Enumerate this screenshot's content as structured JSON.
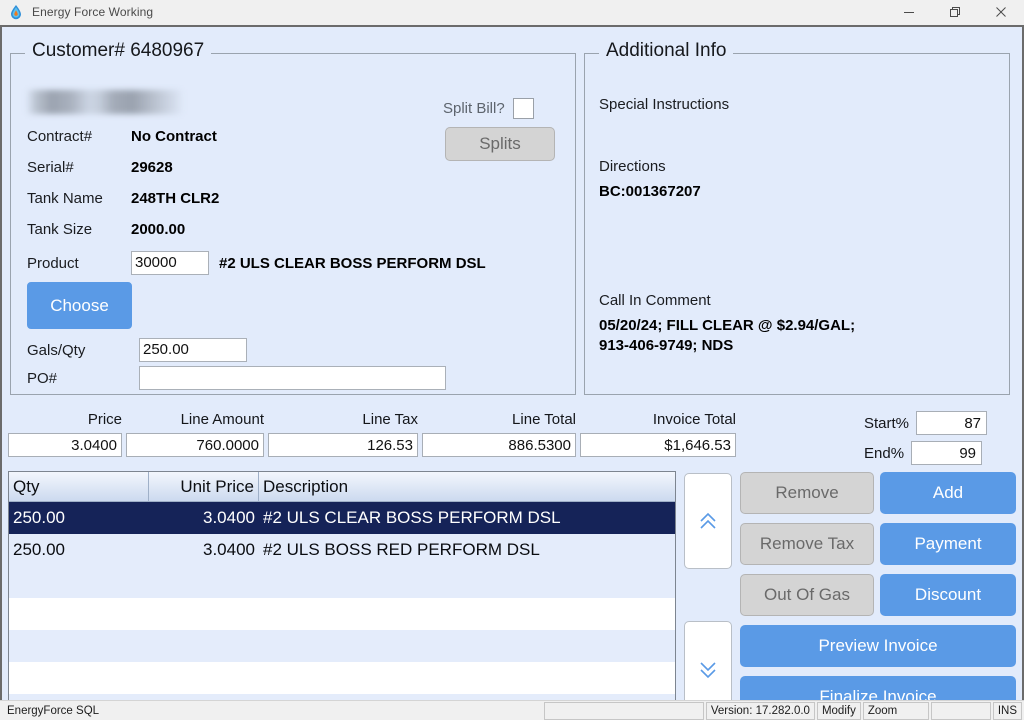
{
  "window": {
    "title": "Energy Force Working",
    "icon": "droplet-icon",
    "controls": {
      "minimize": "minimize-icon",
      "restore": "restore-icon",
      "close": "close-icon"
    }
  },
  "customer_panel": {
    "title": "Customer# 6480967",
    "customer_name_redacted": "",
    "fields": [
      {
        "label": "Contract#",
        "value": "No Contract"
      },
      {
        "label": "Serial#",
        "value": "29628"
      },
      {
        "label": "Tank Name",
        "value": "248TH CLR2"
      },
      {
        "label": "Tank Size",
        "value": "2000.00"
      }
    ],
    "product": {
      "label": "Product",
      "code": "30000",
      "description": "#2 ULS CLEAR BOSS PERFORM DSL"
    },
    "choose_button": "Choose",
    "gals_qty": {
      "label": "Gals/Qty",
      "value": "250.00"
    },
    "po": {
      "label": "PO#",
      "value": ""
    },
    "split_bill": {
      "label": "Split Bill?",
      "checked": false
    },
    "splits_button": "Splits"
  },
  "additional_info": {
    "title": "Additional Info",
    "special_instructions_label": "Special Instructions",
    "special_instructions_value": "",
    "directions_label": "Directions",
    "directions_value": "BC:001367207",
    "call_in_comment_label": "Call In Comment",
    "call_in_comment_line1": "05/20/24; FILL CLEAR @ $2.94/GAL;",
    "call_in_comment_line2": "913-406-9749; NDS"
  },
  "totals": [
    {
      "label": "Price",
      "value": "3.0400"
    },
    {
      "label": "Line Amount",
      "value": "760.0000"
    },
    {
      "label": "Line Tax",
      "value": "126.53"
    },
    {
      "label": "Line Total",
      "value": "886.5300"
    },
    {
      "label": "Invoice Total",
      "value": "$1,646.53"
    }
  ],
  "percents": {
    "start_label": "Start%",
    "start_value": "87",
    "end_label": "End%",
    "end_value": "99"
  },
  "grid": {
    "columns": [
      "Qty",
      "Unit Price",
      "Description"
    ],
    "rows": [
      {
        "qty": "250.00",
        "unit_price": "3.0400",
        "description": "#2 ULS CLEAR BOSS PERFORM DSL",
        "selected": true
      },
      {
        "qty": "250.00",
        "unit_price": "3.0400",
        "description": "#2 ULS BOSS RED PERFORM DSL",
        "selected": false
      },
      {
        "qty": "",
        "unit_price": "",
        "description": "",
        "selected": false
      },
      {
        "qty": "",
        "unit_price": "",
        "description": "",
        "selected": false
      },
      {
        "qty": "",
        "unit_price": "",
        "description": "",
        "selected": false
      },
      {
        "qty": "",
        "unit_price": "",
        "description": "",
        "selected": false
      },
      {
        "qty": "",
        "unit_price": "",
        "description": "",
        "selected": false
      }
    ]
  },
  "nav": {
    "scroll_up": "chevron-double-up-icon",
    "scroll_down": "chevron-double-down-icon"
  },
  "actions": {
    "remove": "Remove",
    "remove_tax": "Remove Tax",
    "out_of_gas": "Out Of Gas",
    "add": "Add",
    "payment": "Payment",
    "discount": "Discount",
    "preview_invoice": "Preview Invoice",
    "finalize_invoice": "Finalize Invoice"
  },
  "statusbar": {
    "app": "EnergyForce SQL",
    "blank": "",
    "version": "Version: 17.282.0.0",
    "mode": "Modify",
    "zoom": "Zoom",
    "blank2": "",
    "insert": "INS"
  },
  "colors": {
    "accent_blue": "#5a9ae6",
    "panel_background": "#e2ebfb",
    "selected_row": "#152358",
    "disabled_button": "#d4d4d4"
  }
}
